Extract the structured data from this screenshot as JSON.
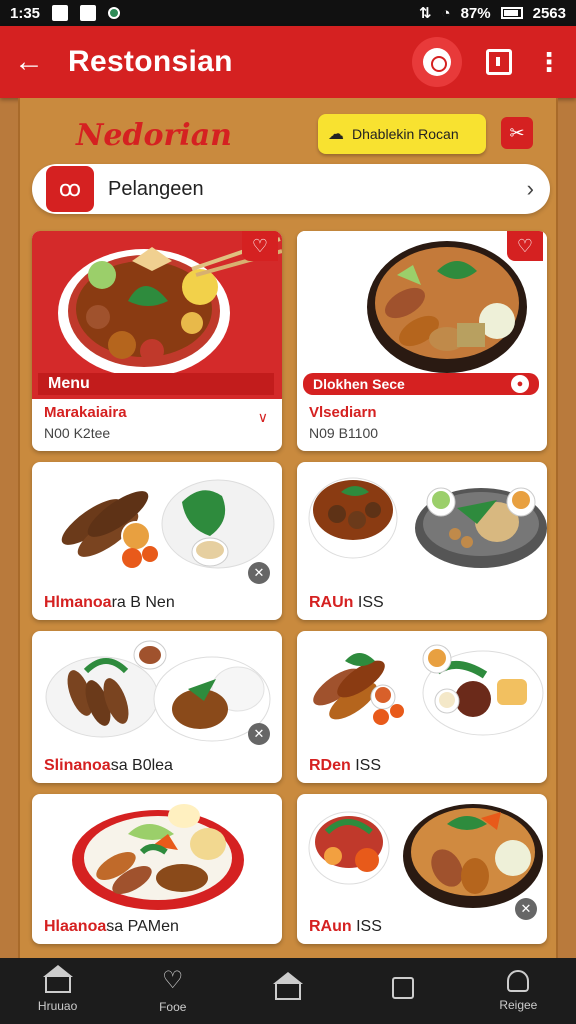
{
  "status_bar": {
    "time": "1:35",
    "battery": "87%",
    "right_value": "2563"
  },
  "app_bar": {
    "title": "Restonsian",
    "back_icon": "back-arrow-icon"
  },
  "section": {
    "title": "Nedorian",
    "action_button": "Dhablekin Rocan"
  },
  "search": {
    "placeholder": "Pelangeen"
  },
  "cards": [
    {
      "strip": "Menu",
      "name": "Marakaiaira",
      "price": "N00 K2tee",
      "bg": "#d42a2a"
    },
    {
      "strip": "Dlokhen Sece",
      "name": "Vlsediarn",
      "price": "N09 B1100",
      "bg": "#ffffff"
    },
    {
      "name_red": "Hlmanoa",
      "name_rest": "ra B Nen"
    },
    {
      "name_red": "RAUn",
      "name_rest": " ISS"
    },
    {
      "name_red": "Slinanoa",
      "name_rest": "sa B0lea"
    },
    {
      "name_red": "RDen",
      "name_rest": " ISS"
    },
    {
      "name_red": "Hlaanoa",
      "name_rest": "sa PAMen"
    },
    {
      "name_red": "RAun",
      "name_rest": " ISS"
    }
  ],
  "bottom_nav": [
    {
      "label": "Hruuao",
      "icon": "home-icon"
    },
    {
      "label": "Fooe",
      "icon": "heart-icon"
    },
    {
      "label": "",
      "icon": "store-icon"
    },
    {
      "label": "",
      "icon": "orders-icon"
    },
    {
      "label": "Reigee",
      "icon": "profile-icon"
    }
  ],
  "colors": {
    "primary": "#d52121",
    "panel": "#c98a3e",
    "accent": "#f8e230"
  }
}
